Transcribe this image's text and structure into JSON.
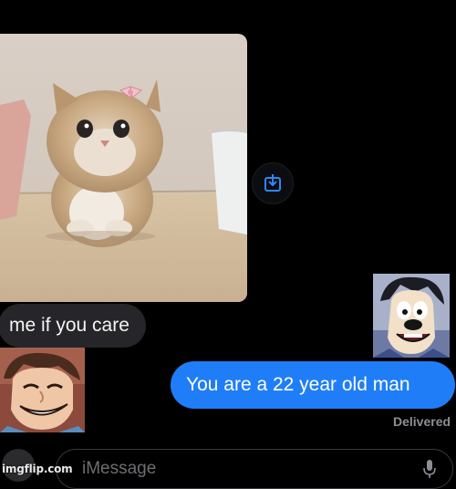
{
  "messages": {
    "incoming_text": "me if you care",
    "outgoing_text": "You are a 22 year old man",
    "status": "Delivered"
  },
  "composer": {
    "placeholder": "iMessage"
  },
  "watermark": "imgflip.com",
  "colors": {
    "background": "#000000",
    "incoming_bubble": "#26262a",
    "outgoing_bubble": "#1f7ef7",
    "status_text": "#8d8e93"
  },
  "icons": [
    "save-to-photos-icon",
    "microphone-icon",
    "apps-icon"
  ]
}
